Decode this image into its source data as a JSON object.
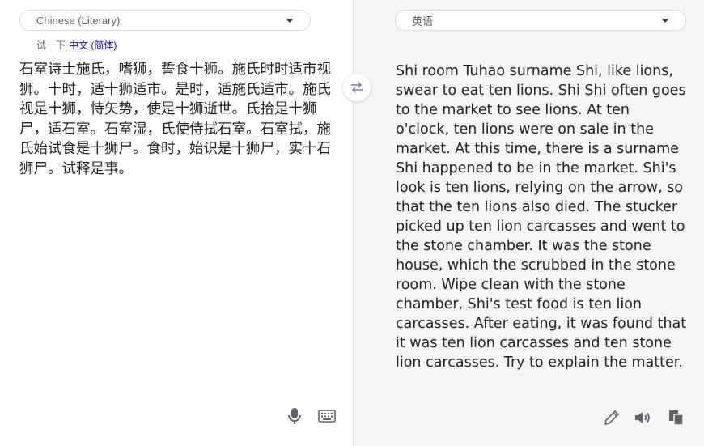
{
  "source": {
    "language_label": "Chinese (Literary)",
    "suggestion_prefix": "试一下",
    "suggestion_link": "中文 (简体)",
    "text": "石室诗士施氏，嗜狮，誓食十狮。施氏时时适市视狮。十时，适十狮适市。是时，适施氏适市。施氏视是十狮，恃矢势，使是十狮逝世。氏拾是十狮尸，适石室。石室湿，氏使侍拭石室。石室拭，施氏始试食是十狮尸。食时，始识是十狮尸，实十石狮尸。试释是事。",
    "icons": {
      "microphone": "microphone-icon",
      "keyboard": "keyboard-icon"
    }
  },
  "target": {
    "language_label": "英语",
    "text": "Shi room Tuhao surname Shi, like lions, swear to eat ten lions. Shi Shi often goes to the market to see lions. At ten o'clock, ten lions were on sale in the market. At this time, there is a surname Shi happened to be in the market. Shi's look is ten lions, relying on the arrow, so that the ten lions also died. The stucker picked up ten lion carcasses and went to the stone chamber. It was the stone house, which the scrubbed in the stone room. Wipe clean with the stone chamber, Shi's test food is ten lion carcasses. After eating, it was found that it was ten lion carcasses and ten stone lion carcasses. Try to explain the matter.",
    "icons": {
      "edit": "pencil-icon",
      "listen": "speaker-icon",
      "copy": "copy-icon"
    }
  },
  "swap_icon": "swap-arrows-icon",
  "colors": {
    "panel_right": "#f5f5f5",
    "text": "#202124",
    "muted": "#5f6368",
    "link": "#1a0dab"
  }
}
